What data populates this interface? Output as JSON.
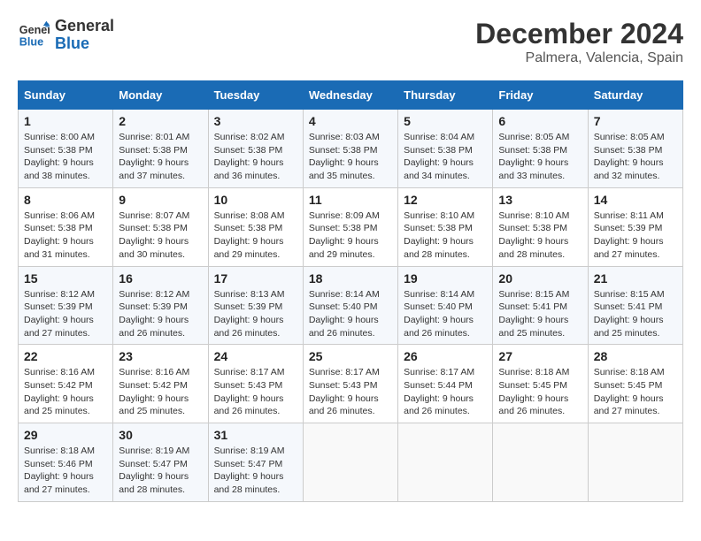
{
  "header": {
    "logo_line1": "General",
    "logo_line2": "Blue",
    "month": "December 2024",
    "location": "Palmera, Valencia, Spain"
  },
  "days_of_week": [
    "Sunday",
    "Monday",
    "Tuesday",
    "Wednesday",
    "Thursday",
    "Friday",
    "Saturday"
  ],
  "weeks": [
    [
      {
        "day": "1",
        "sunrise": "8:00 AM",
        "sunset": "5:38 PM",
        "daylight": "9 hours and 38 minutes."
      },
      {
        "day": "2",
        "sunrise": "8:01 AM",
        "sunset": "5:38 PM",
        "daylight": "9 hours and 37 minutes."
      },
      {
        "day": "3",
        "sunrise": "8:02 AM",
        "sunset": "5:38 PM",
        "daylight": "9 hours and 36 minutes."
      },
      {
        "day": "4",
        "sunrise": "8:03 AM",
        "sunset": "5:38 PM",
        "daylight": "9 hours and 35 minutes."
      },
      {
        "day": "5",
        "sunrise": "8:04 AM",
        "sunset": "5:38 PM",
        "daylight": "9 hours and 34 minutes."
      },
      {
        "day": "6",
        "sunrise": "8:05 AM",
        "sunset": "5:38 PM",
        "daylight": "9 hours and 33 minutes."
      },
      {
        "day": "7",
        "sunrise": "8:05 AM",
        "sunset": "5:38 PM",
        "daylight": "9 hours and 32 minutes."
      }
    ],
    [
      {
        "day": "8",
        "sunrise": "8:06 AM",
        "sunset": "5:38 PM",
        "daylight": "9 hours and 31 minutes."
      },
      {
        "day": "9",
        "sunrise": "8:07 AM",
        "sunset": "5:38 PM",
        "daylight": "9 hours and 30 minutes."
      },
      {
        "day": "10",
        "sunrise": "8:08 AM",
        "sunset": "5:38 PM",
        "daylight": "9 hours and 29 minutes."
      },
      {
        "day": "11",
        "sunrise": "8:09 AM",
        "sunset": "5:38 PM",
        "daylight": "9 hours and 29 minutes."
      },
      {
        "day": "12",
        "sunrise": "8:10 AM",
        "sunset": "5:38 PM",
        "daylight": "9 hours and 28 minutes."
      },
      {
        "day": "13",
        "sunrise": "8:10 AM",
        "sunset": "5:38 PM",
        "daylight": "9 hours and 28 minutes."
      },
      {
        "day": "14",
        "sunrise": "8:11 AM",
        "sunset": "5:39 PM",
        "daylight": "9 hours and 27 minutes."
      }
    ],
    [
      {
        "day": "15",
        "sunrise": "8:12 AM",
        "sunset": "5:39 PM",
        "daylight": "9 hours and 27 minutes."
      },
      {
        "day": "16",
        "sunrise": "8:12 AM",
        "sunset": "5:39 PM",
        "daylight": "9 hours and 26 minutes."
      },
      {
        "day": "17",
        "sunrise": "8:13 AM",
        "sunset": "5:39 PM",
        "daylight": "9 hours and 26 minutes."
      },
      {
        "day": "18",
        "sunrise": "8:14 AM",
        "sunset": "5:40 PM",
        "daylight": "9 hours and 26 minutes."
      },
      {
        "day": "19",
        "sunrise": "8:14 AM",
        "sunset": "5:40 PM",
        "daylight": "9 hours and 26 minutes."
      },
      {
        "day": "20",
        "sunrise": "8:15 AM",
        "sunset": "5:41 PM",
        "daylight": "9 hours and 25 minutes."
      },
      {
        "day": "21",
        "sunrise": "8:15 AM",
        "sunset": "5:41 PM",
        "daylight": "9 hours and 25 minutes."
      }
    ],
    [
      {
        "day": "22",
        "sunrise": "8:16 AM",
        "sunset": "5:42 PM",
        "daylight": "9 hours and 25 minutes."
      },
      {
        "day": "23",
        "sunrise": "8:16 AM",
        "sunset": "5:42 PM",
        "daylight": "9 hours and 25 minutes."
      },
      {
        "day": "24",
        "sunrise": "8:17 AM",
        "sunset": "5:43 PM",
        "daylight": "9 hours and 26 minutes."
      },
      {
        "day": "25",
        "sunrise": "8:17 AM",
        "sunset": "5:43 PM",
        "daylight": "9 hours and 26 minutes."
      },
      {
        "day": "26",
        "sunrise": "8:17 AM",
        "sunset": "5:44 PM",
        "daylight": "9 hours and 26 minutes."
      },
      {
        "day": "27",
        "sunrise": "8:18 AM",
        "sunset": "5:45 PM",
        "daylight": "9 hours and 26 minutes."
      },
      {
        "day": "28",
        "sunrise": "8:18 AM",
        "sunset": "5:45 PM",
        "daylight": "9 hours and 27 minutes."
      }
    ],
    [
      {
        "day": "29",
        "sunrise": "8:18 AM",
        "sunset": "5:46 PM",
        "daylight": "9 hours and 27 minutes."
      },
      {
        "day": "30",
        "sunrise": "8:19 AM",
        "sunset": "5:47 PM",
        "daylight": "9 hours and 28 minutes."
      },
      {
        "day": "31",
        "sunrise": "8:19 AM",
        "sunset": "5:47 PM",
        "daylight": "9 hours and 28 minutes."
      },
      null,
      null,
      null,
      null
    ]
  ],
  "labels": {
    "sunrise": "Sunrise:",
    "sunset": "Sunset:",
    "daylight": "Daylight:"
  }
}
